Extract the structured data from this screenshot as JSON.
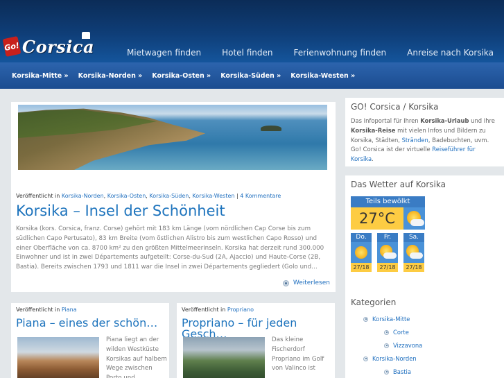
{
  "brand": {
    "logo_go": "Go!",
    "logo_name": "Corsica"
  },
  "main_nav": [
    "Mietwagen finden",
    "Hotel finden",
    "Ferienwohnung finden",
    "Anreise nach Korsika"
  ],
  "sub_nav": [
    "Korsika-Mitte »",
    "Korsika-Norden »",
    "Korsika-Osten »",
    "Korsika-Süden »",
    "Korsika-Westen »"
  ],
  "featured": {
    "meta_prefix": "Veröffentlicht in",
    "categories": [
      "Korsika-Norden",
      "Korsika-Osten",
      "Korsika-Süden",
      "Korsika-Westen"
    ],
    "comments": "4 Kommentare",
    "title": "Korsika – Insel der Schönheit",
    "excerpt": "Korsika (kors. Corsica, franz. Corse) gehört mit 183 km Länge (vom nördlichen Cap Corse bis zum südlichen Capo Pertusato), 83 km Breite (vom östlichen Alistro bis zum westlichen Capo Rosso) und einer Oberfläche von ca. 8700 km² zu den größten Mittelmeerinseln. Korsika hat derzeit rund 300.000 Einwohner und ist in zwei Départements aufgeteilt: Corse-du-Sud (2A, Ajaccio) und Haute-Corse (2B, Bastia). Bereits zwischen 1793 und 1811 war die Insel in zwei Départements gegliedert (Golo und…",
    "read_more": "Weiterlesen"
  },
  "posts": [
    {
      "meta_prefix": "Veröffentlicht in",
      "category": "Piana",
      "title": "Piana – eines der schön…",
      "text": "Piana liegt an der wilden Westküste Korsikas auf halbem Wege zwischen Porto und"
    },
    {
      "meta_prefix": "Veröffentlicht in",
      "category": "Propriano",
      "title": "Propriano – für jeden Gesch…",
      "text": "Das kleine Fischerdorf Propriano im Golf von Valinco ist"
    }
  ],
  "sidebar": {
    "about": {
      "title": "GO! Corsica / Korsika",
      "t1": "Das Infoportal für Ihren ",
      "b1": "Korsika-Urlaub",
      "t2": " und Ihre ",
      "b2": "Korsika-Reise",
      "t3": " mit vielen Infos und Bildern zu Korsika, Städten, ",
      "l1": "Stränden",
      "t4": ", Badebuchten, uvm. Go! Corsica ist der virtuelle ",
      "l2": "Reiseführer für Korsika",
      "t5": "."
    },
    "weather": {
      "title": "Das Wetter auf Korsika",
      "now_label": "Teils bewölkt",
      "now_temp": "27°C",
      "now_icon": "sun-cloud-icon",
      "days": [
        {
          "label": "Do.",
          "temps": "27/18",
          "icon": "sun-icon"
        },
        {
          "label": "Fr.",
          "temps": "27/18",
          "icon": "sun-cloud-icon"
        },
        {
          "label": "Sa.",
          "temps": "27/18",
          "icon": "sun-cloud-icon"
        }
      ]
    },
    "categories": {
      "title": "Kategorien",
      "items": [
        "Korsika-Mitte",
        "Corte",
        "Vizzavona",
        "Korsika-Norden",
        "Bastia"
      ]
    }
  },
  "colors": {
    "header_dark": "#0b2c57",
    "subnav": "#1b4c90",
    "link": "#1f6fbf",
    "title": "#1e74bd",
    "weather_yellow": "#fdcc43",
    "weather_blue": "#3a7cc4"
  }
}
